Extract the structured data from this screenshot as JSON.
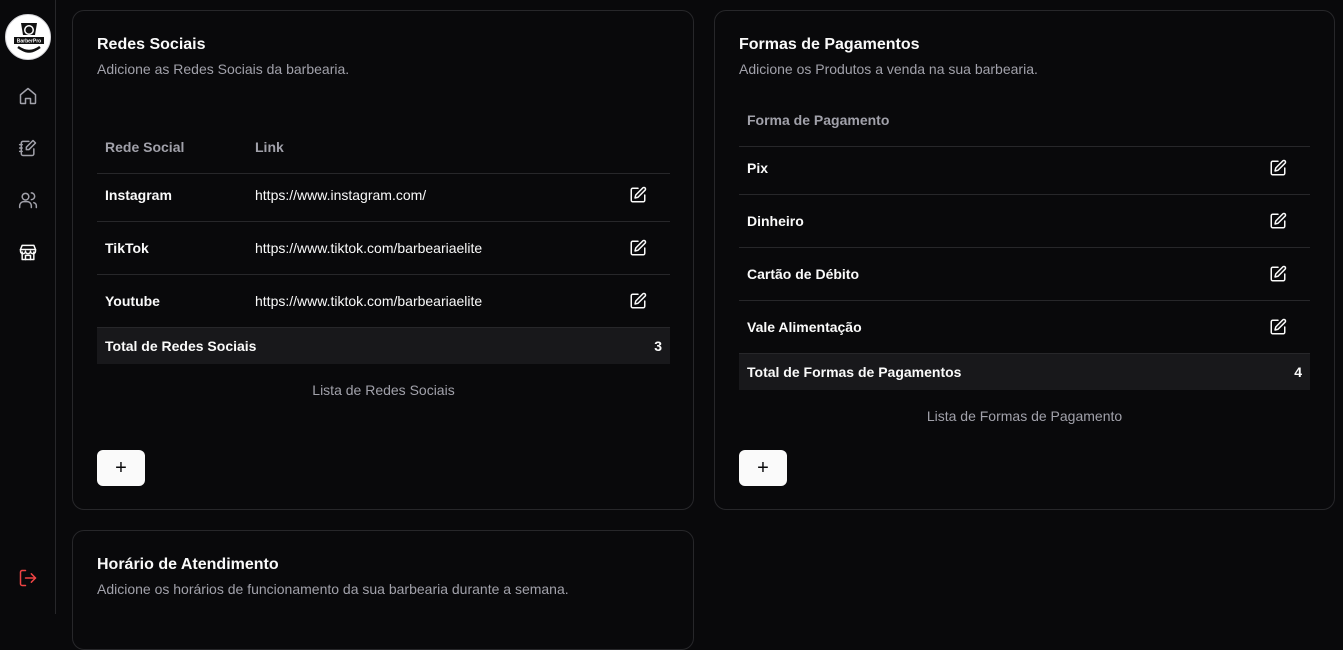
{
  "logo": {
    "text": "BarberPro"
  },
  "sidebar": {
    "items": [
      {
        "icon": "home-icon"
      },
      {
        "icon": "clipboard-edit-icon"
      },
      {
        "icon": "users-icon"
      },
      {
        "icon": "store-icon"
      }
    ],
    "logout_icon": "logout-icon"
  },
  "social": {
    "title": "Redes Sociais",
    "description": "Adicione as Redes Sociais da barbearia.",
    "columns": [
      "Rede Social",
      "Link"
    ],
    "rows": [
      {
        "name": "Instagram",
        "link": "https://www.instagram.com/"
      },
      {
        "name": "TikTok",
        "link": "https://www.tiktok.com/barbeariaelite"
      },
      {
        "name": "Youtube",
        "link": "https://www.tiktok.com/barbeariaelite"
      }
    ],
    "total_label": "Total de Redes Sociais",
    "total_value": "3",
    "caption": "Lista de Redes Sociais",
    "add_label": "+"
  },
  "payments": {
    "title": "Formas de Pagamentos",
    "description": "Adicione os Produtos a venda na sua barbearia.",
    "columns": [
      "Forma de Pagamento"
    ],
    "rows": [
      {
        "name": "Pix"
      },
      {
        "name": "Dinheiro"
      },
      {
        "name": "Cartão de Débito"
      },
      {
        "name": "Vale Alimentação"
      }
    ],
    "total_label": "Total de Formas de Pagamentos",
    "total_value": "4",
    "caption": "Lista de Formas de Pagamento",
    "add_label": "+"
  },
  "hours": {
    "title": "Horário de Atendimento",
    "description": "Adicione os horários de funcionamento da sua barbearia durante a semana."
  },
  "colors": {
    "background": "#09090b",
    "border": "#27272a",
    "muted": "#a1a1aa",
    "logout": "#ef4444"
  }
}
